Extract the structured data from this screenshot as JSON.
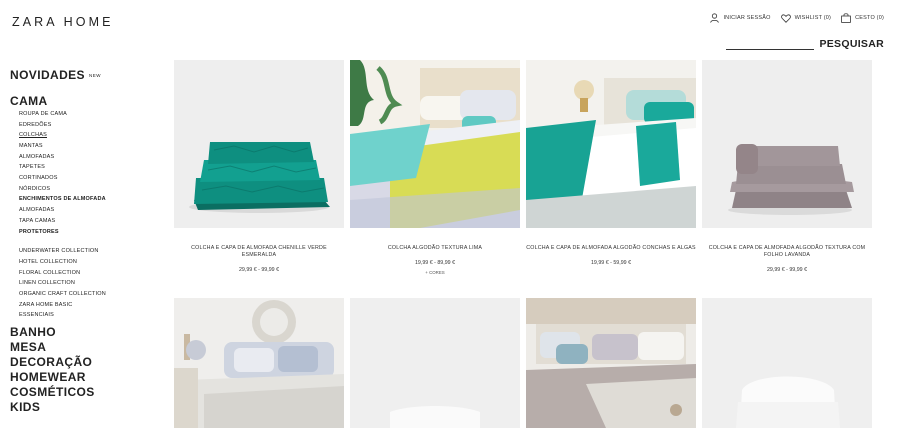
{
  "header": {
    "logo": "ZARA HOME",
    "login": "INICIAR SESSÃO",
    "wishlist": "WISHLIST (0)",
    "basket": "CESTO (0)",
    "search_label": "PESQUISAR"
  },
  "sidebar": {
    "novidades": "NOVIDADES",
    "new_badge": "NEW",
    "cama": "CAMA",
    "cama_items": [
      "ROUPA DE CAMA",
      "EDREDÕES",
      "COLCHAS",
      "MANTAS",
      "ALMOFADAS",
      "TAPETES",
      "CORTINADOS",
      "NÓRDICOS",
      "ENCHIMENTOS DE ALMOFADA",
      "ALMOFADAS",
      "TAPA CAMAS",
      "PROTETORES"
    ],
    "collections": [
      "UNDERWATER COLLECTION",
      "HOTEL COLLECTION",
      "FLORAL COLLECTION",
      "LINEN COLLECTION",
      "ORGANIC CRAFT COLLECTION",
      "ZARA HOME BASIC",
      "ESSENCIAIS"
    ],
    "categories": [
      "BANHO",
      "MESA",
      "DECORAÇÃO",
      "HOMEWEAR",
      "COSMÉTICOS",
      "KIDS"
    ]
  },
  "products": [
    {
      "title": "COLCHA E CAPA DE ALMOFADA CHENILLE VERDE ESMERALDA",
      "price": "29,99 € - 99,99 €",
      "colors": ""
    },
    {
      "title": "COLCHA ALGODÃO TEXTURA LIMA",
      "price": "19,99 € - 89,99 €",
      "colors": "+ CORES"
    },
    {
      "title": "COLCHA E CAPA DE ALMOFADA ALGODÃO CONCHAS E ALGAS",
      "price": "19,99 € - 59,99 €",
      "colors": ""
    },
    {
      "title": "COLCHA E CAPA DE ALMOFADA ALGODÃO TEXTURA COM FOLHO LAVANDA",
      "price": "29,99 € - 99,99 €",
      "colors": ""
    }
  ],
  "colors": {
    "emerald": "#0e8f80",
    "lime": "#d8dc55",
    "teal": "#1aa99b",
    "lavender": "#9b8f93"
  }
}
